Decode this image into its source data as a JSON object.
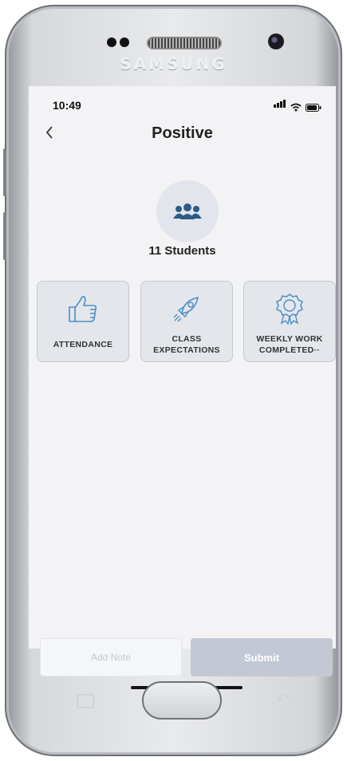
{
  "device": {
    "brand": "SAMSUNG"
  },
  "status_bar": {
    "time": "10:49"
  },
  "header": {
    "title": "Positive",
    "back_icon": "chevron-left-icon"
  },
  "group": {
    "icon": "users-icon",
    "count_label": "11 Students"
  },
  "behaviors": [
    {
      "icon": "thumbs-up-icon",
      "label_line1": "ATTENDANCE",
      "label_line2": ""
    },
    {
      "icon": "rocket-icon",
      "label_line1": "CLASS",
      "label_line2": "EXPECTATIONS"
    },
    {
      "icon": "award-ribbon-icon",
      "label_line1": "WEEKLY WORK",
      "label_line2": "COMPLETED··"
    }
  ],
  "footer": {
    "add_note_placeholder": "Add Note",
    "submit_label": "Submit"
  },
  "colors": {
    "accent": "#2f5a86",
    "icon_line": "#4a8fc7",
    "submit_disabled": "#c3c9d4",
    "card_bg": "#e3e6ea"
  }
}
